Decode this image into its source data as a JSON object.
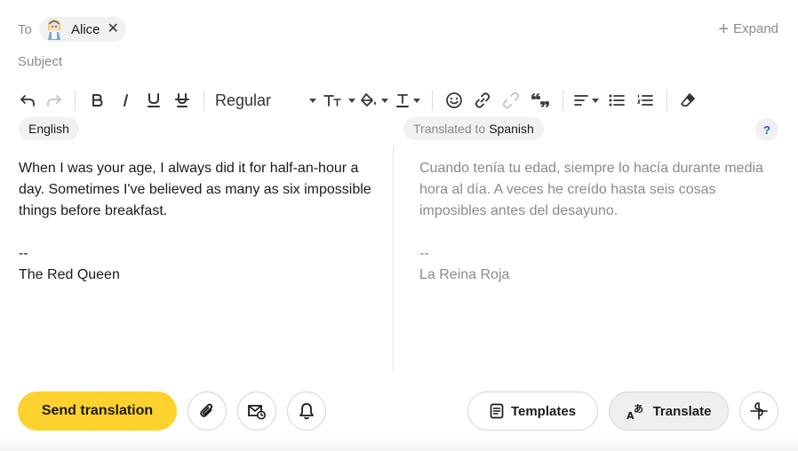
{
  "compose": {
    "to_label": "To",
    "recipient": {
      "name": "Alice"
    },
    "expand_label": "Expand",
    "subject_placeholder": "Subject"
  },
  "toolbar": {
    "font_style": "Regular",
    "icons": [
      "undo-icon",
      "redo-icon",
      "bold-icon",
      "italic-icon",
      "underline-icon",
      "strikethrough-icon",
      "text-size-icon",
      "fill-color-icon",
      "text-color-icon",
      "emoji-icon",
      "link-icon",
      "unlink-icon",
      "quote-icon",
      "align-icon",
      "bulleted-list-icon",
      "numbered-list-icon",
      "clear-formatting-icon"
    ]
  },
  "translation": {
    "source_language": "English",
    "translated_to_label": "Translated to",
    "target_language": "Spanish",
    "help_label": "?",
    "source_text": "When I was your age, I always did it for half-an-hour a day. Sometimes I've believed as many as six impossible things before breakfast.\n\n--\nThe Red Queen",
    "translated_text": "Cuando tenía tu edad, siempre lo hacía durante media hora al día. A veces he creído hasta seis cosas imposibles antes del desayuno.\n\n--\nLa Reina Roja"
  },
  "actions": {
    "send_label": "Send translation",
    "templates_label": "Templates",
    "translate_label": "Translate"
  },
  "colors": {
    "accent": "#fdd22e",
    "link_blue": "#1f5fd6",
    "muted_text": "#8a8a8a"
  }
}
